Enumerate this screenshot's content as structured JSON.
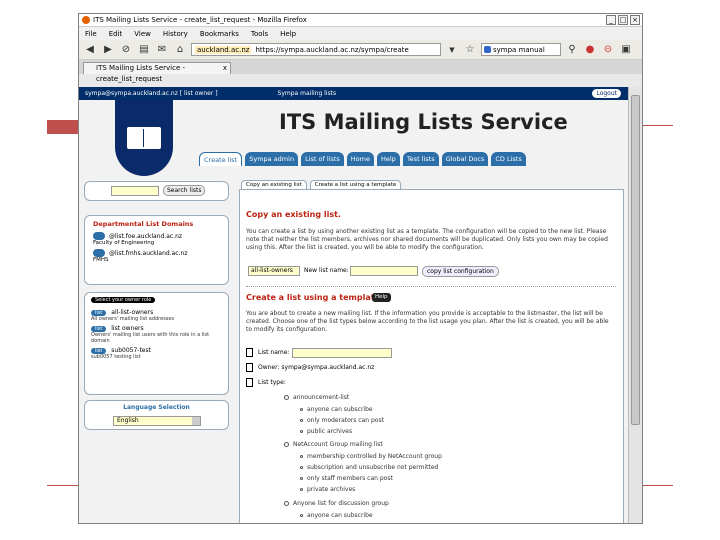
{
  "browser": {
    "window_title": "ITS Mailing Lists Service - create_list_request - Mozilla Firefox",
    "window_buttons": [
      "_",
      "□",
      "×"
    ],
    "menu": [
      "File",
      "Edit",
      "View",
      "History",
      "Bookmarks",
      "Tools",
      "Help"
    ],
    "url_host": "auckland.ac.nz",
    "url": "https://sympa.auckland.ac.nz/sympa/create",
    "search_placeholder": "sympa manual",
    "tab_title": "ITS Mailing Lists Service - create_list_request",
    "tab_close": "x"
  },
  "page": {
    "login_info": "sympa@sympa.auckland.ac.nz  [ list owner ]",
    "banner_center": "Sympa mailing lists",
    "logout": "Logout",
    "service_title": "ITS Mailing Lists Service",
    "tabs": [
      "Create list",
      "Sympa admin",
      "List of lists",
      "Home",
      "Help",
      "Test lists",
      "Global Docs",
      "CD Lists"
    ],
    "sidebar": {
      "search_button": "Search lists",
      "domains_title": "Departmental List Domains",
      "domains": [
        {
          "name": "@list.foe.auckland.ac.nz",
          "sub": "Faculty of Engineering"
        },
        {
          "name": "@list.fmhs.auckland.ac.nz",
          "sub": "FMHS"
        }
      ],
      "roles_header": "Select your owner role",
      "roles": [
        {
          "pill": "list",
          "name": "all-list-owners",
          "desc": "All owners' mailing list addresses"
        },
        {
          "pill": "list",
          "name": "list owners",
          "desc": "Owners' mailing list users with this role in a list domain"
        },
        {
          "pill": "list",
          "name": "sub0057-test",
          "desc": "sub0057 testing list"
        }
      ],
      "language_label": "Language Selection",
      "language_value": "English"
    },
    "subtabs": [
      "Copy an existing list",
      "Create a list using a template"
    ],
    "copy_heading": "Copy an existing list.",
    "copy_text": "You can create a list by using another existing list as a template. The configuration will be copied to the new list. Please note that neither the list members, archives nor shared documents will be duplicated. Only lists you own may be copied using this. After the list is created, you will be able to modify the configuration.",
    "source_list_value": "all-list-owners",
    "new_list_label": "New list name:",
    "copy_button": "copy list configuration",
    "template_heading": "Create a list using a template",
    "help_badge": "Help",
    "template_text": "You are about to create a new mailing list. If the information you provide is acceptable to the listmaster, the list will be created. Choose one of the list types below according to the list usage you plan. After the list is created, you will be able to modify its configuration.",
    "list_name_label": "List name:",
    "owner_label": "Owner: sympa@sympa.auckland.ac.nz",
    "list_type_label": "List type:",
    "list_types": [
      {
        "name": "announcement-list",
        "options": [
          "anyone can subscribe",
          "only moderators can post",
          "public archives"
        ]
      },
      {
        "name": "NetAccount Group mailing list",
        "options": [
          "membership controlled by NetAccount group",
          "subscription and unsubscribe not permitted",
          "only staff members can post",
          "private archives"
        ]
      },
      {
        "name": "Anyone list for discussion group",
        "options": [
          "anyone can subscribe"
        ]
      }
    ]
  }
}
